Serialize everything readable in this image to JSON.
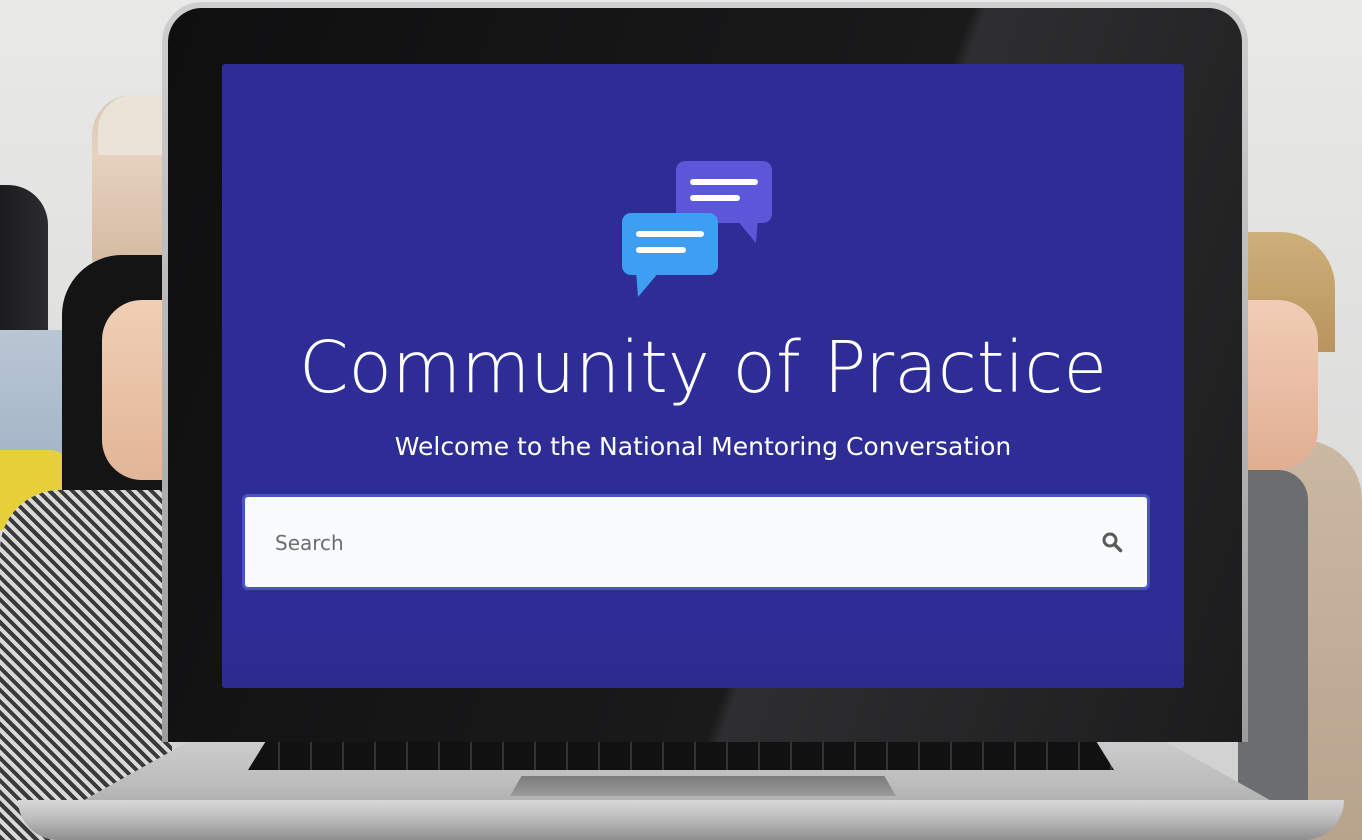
{
  "page": {
    "title": "Community of Practice",
    "subtitle": "Welcome to the National Mentoring Conversation"
  },
  "search": {
    "placeholder": "Search",
    "value": ""
  },
  "icons": {
    "logo": "chat-bubbles-icon",
    "search": "magnifying-glass-icon"
  },
  "colors": {
    "screen_background": "#2e2d96",
    "search_border": "#4a55c4",
    "bubble_front": "#3d9ef2",
    "bubble_back": "#5c57d9"
  }
}
